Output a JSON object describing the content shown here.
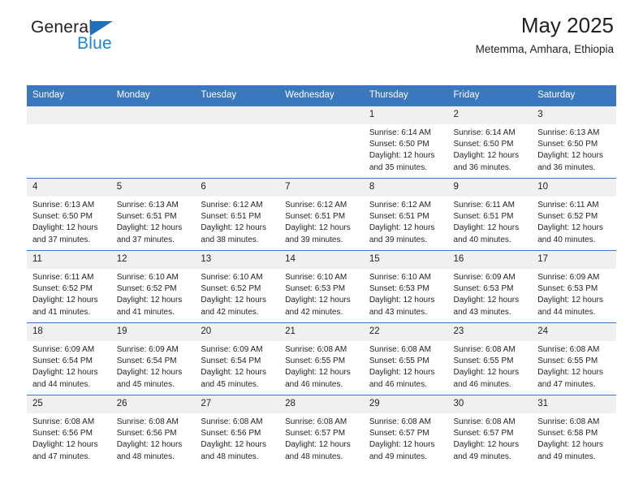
{
  "brand": {
    "name_top": "General",
    "name_bottom": "Blue",
    "triangle_color": "#1e6fbd",
    "blue_text_color": "#1e84d6"
  },
  "header": {
    "title": "May 2025",
    "subtitle": "Metemma, Amhara, Ethiopia"
  },
  "theme": {
    "header_blue": "#3a77bf",
    "daynum_bg": "#f0f0f0",
    "text": "#231f20"
  },
  "weekdays": [
    "Sunday",
    "Monday",
    "Tuesday",
    "Wednesday",
    "Thursday",
    "Friday",
    "Saturday"
  ],
  "weeks": [
    [
      {
        "day": "",
        "sunrise": "",
        "sunset": "",
        "daylight": ""
      },
      {
        "day": "",
        "sunrise": "",
        "sunset": "",
        "daylight": ""
      },
      {
        "day": "",
        "sunrise": "",
        "sunset": "",
        "daylight": ""
      },
      {
        "day": "",
        "sunrise": "",
        "sunset": "",
        "daylight": ""
      },
      {
        "day": "1",
        "sunrise": "Sunrise: 6:14 AM",
        "sunset": "Sunset: 6:50 PM",
        "daylight": "Daylight: 12 hours and 35 minutes."
      },
      {
        "day": "2",
        "sunrise": "Sunrise: 6:14 AM",
        "sunset": "Sunset: 6:50 PM",
        "daylight": "Daylight: 12 hours and 36 minutes."
      },
      {
        "day": "3",
        "sunrise": "Sunrise: 6:13 AM",
        "sunset": "Sunset: 6:50 PM",
        "daylight": "Daylight: 12 hours and 36 minutes."
      }
    ],
    [
      {
        "day": "4",
        "sunrise": "Sunrise: 6:13 AM",
        "sunset": "Sunset: 6:50 PM",
        "daylight": "Daylight: 12 hours and 37 minutes."
      },
      {
        "day": "5",
        "sunrise": "Sunrise: 6:13 AM",
        "sunset": "Sunset: 6:51 PM",
        "daylight": "Daylight: 12 hours and 37 minutes."
      },
      {
        "day": "6",
        "sunrise": "Sunrise: 6:12 AM",
        "sunset": "Sunset: 6:51 PM",
        "daylight": "Daylight: 12 hours and 38 minutes."
      },
      {
        "day": "7",
        "sunrise": "Sunrise: 6:12 AM",
        "sunset": "Sunset: 6:51 PM",
        "daylight": "Daylight: 12 hours and 39 minutes."
      },
      {
        "day": "8",
        "sunrise": "Sunrise: 6:12 AM",
        "sunset": "Sunset: 6:51 PM",
        "daylight": "Daylight: 12 hours and 39 minutes."
      },
      {
        "day": "9",
        "sunrise": "Sunrise: 6:11 AM",
        "sunset": "Sunset: 6:51 PM",
        "daylight": "Daylight: 12 hours and 40 minutes."
      },
      {
        "day": "10",
        "sunrise": "Sunrise: 6:11 AM",
        "sunset": "Sunset: 6:52 PM",
        "daylight": "Daylight: 12 hours and 40 minutes."
      }
    ],
    [
      {
        "day": "11",
        "sunrise": "Sunrise: 6:11 AM",
        "sunset": "Sunset: 6:52 PM",
        "daylight": "Daylight: 12 hours and 41 minutes."
      },
      {
        "day": "12",
        "sunrise": "Sunrise: 6:10 AM",
        "sunset": "Sunset: 6:52 PM",
        "daylight": "Daylight: 12 hours and 41 minutes."
      },
      {
        "day": "13",
        "sunrise": "Sunrise: 6:10 AM",
        "sunset": "Sunset: 6:52 PM",
        "daylight": "Daylight: 12 hours and 42 minutes."
      },
      {
        "day": "14",
        "sunrise": "Sunrise: 6:10 AM",
        "sunset": "Sunset: 6:53 PM",
        "daylight": "Daylight: 12 hours and 42 minutes."
      },
      {
        "day": "15",
        "sunrise": "Sunrise: 6:10 AM",
        "sunset": "Sunset: 6:53 PM",
        "daylight": "Daylight: 12 hours and 43 minutes."
      },
      {
        "day": "16",
        "sunrise": "Sunrise: 6:09 AM",
        "sunset": "Sunset: 6:53 PM",
        "daylight": "Daylight: 12 hours and 43 minutes."
      },
      {
        "day": "17",
        "sunrise": "Sunrise: 6:09 AM",
        "sunset": "Sunset: 6:53 PM",
        "daylight": "Daylight: 12 hours and 44 minutes."
      }
    ],
    [
      {
        "day": "18",
        "sunrise": "Sunrise: 6:09 AM",
        "sunset": "Sunset: 6:54 PM",
        "daylight": "Daylight: 12 hours and 44 minutes."
      },
      {
        "day": "19",
        "sunrise": "Sunrise: 6:09 AM",
        "sunset": "Sunset: 6:54 PM",
        "daylight": "Daylight: 12 hours and 45 minutes."
      },
      {
        "day": "20",
        "sunrise": "Sunrise: 6:09 AM",
        "sunset": "Sunset: 6:54 PM",
        "daylight": "Daylight: 12 hours and 45 minutes."
      },
      {
        "day": "21",
        "sunrise": "Sunrise: 6:08 AM",
        "sunset": "Sunset: 6:55 PM",
        "daylight": "Daylight: 12 hours and 46 minutes."
      },
      {
        "day": "22",
        "sunrise": "Sunrise: 6:08 AM",
        "sunset": "Sunset: 6:55 PM",
        "daylight": "Daylight: 12 hours and 46 minutes."
      },
      {
        "day": "23",
        "sunrise": "Sunrise: 6:08 AM",
        "sunset": "Sunset: 6:55 PM",
        "daylight": "Daylight: 12 hours and 46 minutes."
      },
      {
        "day": "24",
        "sunrise": "Sunrise: 6:08 AM",
        "sunset": "Sunset: 6:55 PM",
        "daylight": "Daylight: 12 hours and 47 minutes."
      }
    ],
    [
      {
        "day": "25",
        "sunrise": "Sunrise: 6:08 AM",
        "sunset": "Sunset: 6:56 PM",
        "daylight": "Daylight: 12 hours and 47 minutes."
      },
      {
        "day": "26",
        "sunrise": "Sunrise: 6:08 AM",
        "sunset": "Sunset: 6:56 PM",
        "daylight": "Daylight: 12 hours and 48 minutes."
      },
      {
        "day": "27",
        "sunrise": "Sunrise: 6:08 AM",
        "sunset": "Sunset: 6:56 PM",
        "daylight": "Daylight: 12 hours and 48 minutes."
      },
      {
        "day": "28",
        "sunrise": "Sunrise: 6:08 AM",
        "sunset": "Sunset: 6:57 PM",
        "daylight": "Daylight: 12 hours and 48 minutes."
      },
      {
        "day": "29",
        "sunrise": "Sunrise: 6:08 AM",
        "sunset": "Sunset: 6:57 PM",
        "daylight": "Daylight: 12 hours and 49 minutes."
      },
      {
        "day": "30",
        "sunrise": "Sunrise: 6:08 AM",
        "sunset": "Sunset: 6:57 PM",
        "daylight": "Daylight: 12 hours and 49 minutes."
      },
      {
        "day": "31",
        "sunrise": "Sunrise: 6:08 AM",
        "sunset": "Sunset: 6:58 PM",
        "daylight": "Daylight: 12 hours and 49 minutes."
      }
    ]
  ]
}
